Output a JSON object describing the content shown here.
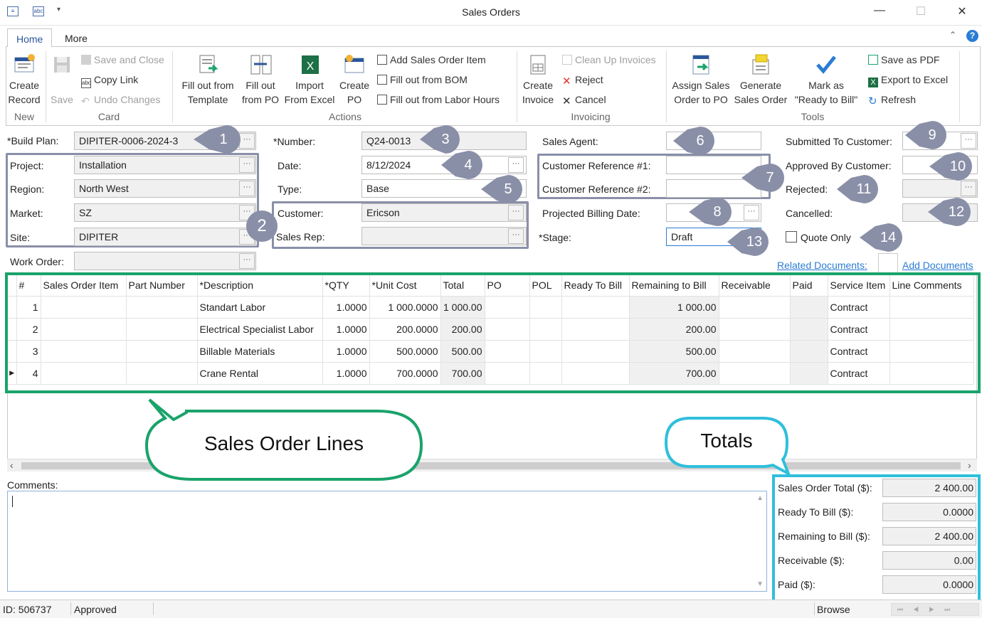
{
  "window": {
    "title": "Sales Orders"
  },
  "ribbon": {
    "tabs": [
      "Home",
      "More"
    ],
    "groups": {
      "new": "New",
      "card": "Card",
      "actions": "Actions",
      "invoicing": "Invoicing",
      "tools": "Tools"
    },
    "create_record": [
      "Create",
      "Record"
    ],
    "save": "Save",
    "save_close": "Save and Close",
    "copy_link": "Copy Link",
    "undo": "Undo Changes",
    "fill_template": [
      "Fill out from",
      "Template"
    ],
    "fill_po": [
      "Fill out",
      "from PO"
    ],
    "import_excel": [
      "Import",
      "From Excel"
    ],
    "create_po": [
      "Create",
      "PO"
    ],
    "add_item": "Add Sales Order Item",
    "fill_bom": "Fill out from BOM",
    "fill_labor": "Fill out from Labor Hours",
    "create_invoice": [
      "Create",
      "Invoice"
    ],
    "clean_up": "Clean Up Invoices",
    "reject": "Reject",
    "cancel": "Cancel",
    "assign": [
      "Assign Sales",
      "Order to PO"
    ],
    "generate": [
      "Generate",
      "Sales Order"
    ],
    "mark": [
      "Mark as",
      "\"Ready to Bill\""
    ],
    "save_pdf": "Save as PDF",
    "export_excel": "Export to Excel",
    "refresh": "Refresh"
  },
  "form": {
    "build_plan": {
      "label": "*Build Plan:",
      "value": "DIPITER-0006-2024-3"
    },
    "project": {
      "label": "Project:",
      "value": "Installation"
    },
    "region": {
      "label": "Region:",
      "value": "North West"
    },
    "market": {
      "label": "Market:",
      "value": "SZ"
    },
    "site": {
      "label": "Site:",
      "value": "DIPITER"
    },
    "work_order": {
      "label": "Work Order:",
      "value": ""
    },
    "number": {
      "label": "*Number:",
      "value": "Q24-0013"
    },
    "date": {
      "label": "Date:",
      "value": "8/12/2024"
    },
    "type": {
      "label": "Type:",
      "value": "Base"
    },
    "customer": {
      "label": "Customer:",
      "value": "Ericson"
    },
    "sales_rep": {
      "label": "Sales Rep:",
      "value": ""
    },
    "sales_agent": {
      "label": "Sales Agent:",
      "value": ""
    },
    "cust_ref1": {
      "label": "Customer Reference #1:",
      "value": ""
    },
    "cust_ref2": {
      "label": "Customer Reference #2:",
      "value": ""
    },
    "proj_billing": {
      "label": "Projected Billing Date:",
      "value": ""
    },
    "stage": {
      "label": "*Stage:",
      "value": "Draft"
    },
    "submitted": {
      "label": "Submitted To Customer:",
      "value": ""
    },
    "approved": {
      "label": "Approved By Customer:",
      "value": ""
    },
    "rejected": {
      "label": "Rejected:",
      "value": ""
    },
    "cancelled": {
      "label": "Cancelled:",
      "value": ""
    },
    "quote_only": {
      "label": "Quote Only",
      "checked": false
    },
    "related_docs": "Related Documents:",
    "add_docs": "Add Documents"
  },
  "callouts": [
    "1",
    "2",
    "3",
    "4",
    "5",
    "6",
    "7",
    "8",
    "9",
    "10",
    "11",
    "12",
    "13",
    "14"
  ],
  "callout_text": {
    "lines": "Sales Order Lines",
    "totals": "Totals"
  },
  "grid": {
    "columns": [
      "#",
      "Sales Order Item",
      "Part Number",
      "*Description",
      "*QTY",
      "*Unit Cost",
      "Total",
      "PO",
      "POL",
      "Ready To Bill",
      "Remaining to Bill",
      "Receivable",
      "Paid",
      "Service Item",
      "Line Comments"
    ],
    "rows": [
      {
        "n": "1",
        "desc": "Standart Labor",
        "qty": "1.0000",
        "cost": "1 000.0000",
        "total": "1 000.00",
        "rem": "1 000.00",
        "svc": "Contract"
      },
      {
        "n": "2",
        "desc": "Electrical Specialist Labor",
        "qty": "1.0000",
        "cost": "200.0000",
        "total": "200.00",
        "rem": "200.00",
        "svc": "Contract"
      },
      {
        "n": "3",
        "desc": "Billable Materials",
        "qty": "1.0000",
        "cost": "500.0000",
        "total": "500.00",
        "rem": "500.00",
        "svc": "Contract"
      },
      {
        "n": "4",
        "desc": "Crane Rental",
        "qty": "1.0000",
        "cost": "700.0000",
        "total": "700.00",
        "rem": "700.00",
        "svc": "Contract"
      }
    ]
  },
  "comments_label": "Comments:",
  "totals": [
    {
      "label": "Sales Order Total ($):",
      "value": "2 400.00"
    },
    {
      "label": "Ready To Bill ($):",
      "value": "0.0000"
    },
    {
      "label": "Remaining to Bill ($):",
      "value": "2 400.00"
    },
    {
      "label": "Receivable ($):",
      "value": "0.00"
    },
    {
      "label": "Paid ($):",
      "value": "0.0000"
    }
  ],
  "status": {
    "id": "ID: 506737",
    "state": "Approved",
    "mode": "Browse"
  },
  "colors": {
    "accent": "#2b579a",
    "callout_gray": "#8a8fa8",
    "green": "#1aa36b",
    "cyan": "#2fbfdc"
  }
}
